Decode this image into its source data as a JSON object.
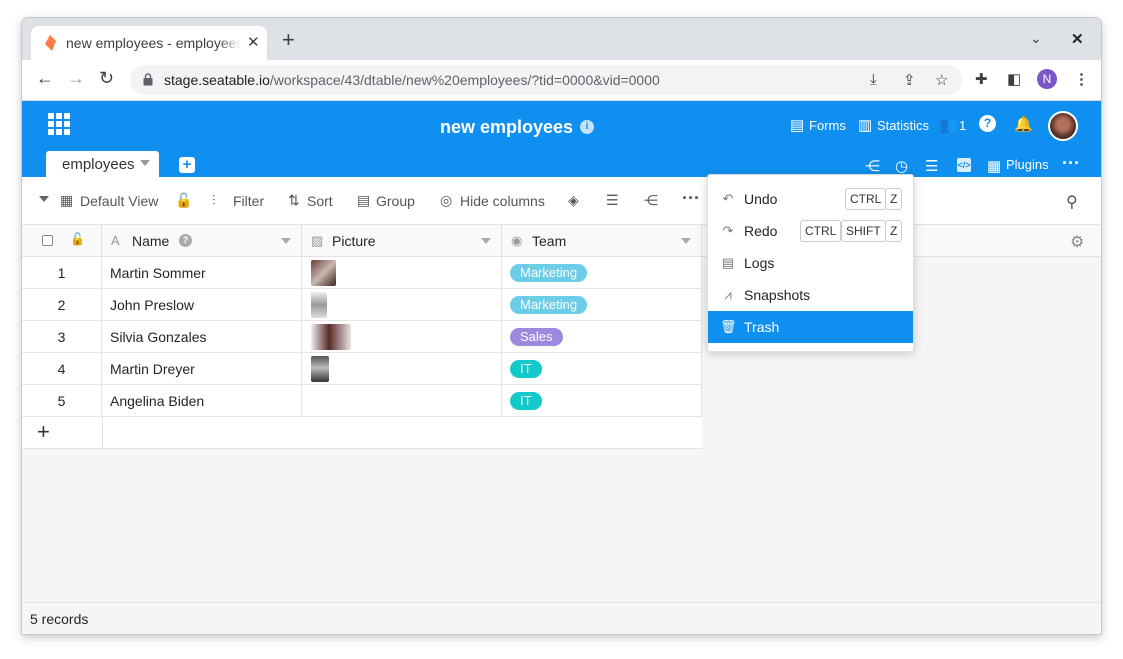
{
  "browser": {
    "tab_title": "new employees - employees",
    "url_host": "stage.seatable.io",
    "url_path": "/workspace/43/dtable/new%20employees/?tid=0000&vid=0000",
    "profile_initial": "N"
  },
  "app": {
    "base_title": "new employees",
    "header_links": {
      "forms": "Forms",
      "statistics": "Statistics",
      "collaborators_count": "1"
    },
    "table_tab": "employees",
    "plugins": "Plugins"
  },
  "viewbar": {
    "view_name": "Default View",
    "filter": "Filter",
    "sort": "Sort",
    "group": "Group",
    "hide_columns": "Hide columns"
  },
  "columns": {
    "name": "Name",
    "picture": "Picture",
    "team": "Team"
  },
  "rows": [
    {
      "num": "1",
      "name": "Martin Sommer",
      "team": "Marketing",
      "team_color": "#6dcce6",
      "has_picture": true
    },
    {
      "num": "2",
      "name": "John Preslow",
      "team": "Marketing",
      "team_color": "#6dcce6",
      "has_picture": true
    },
    {
      "num": "3",
      "name": "Silvia Gonzales",
      "team": "Sales",
      "team_color": "#9c8ae0",
      "has_picture": true
    },
    {
      "num": "4",
      "name": "Martin Dreyer",
      "team": "IT",
      "team_color": "#14c9c9",
      "has_picture": true
    },
    {
      "num": "5",
      "name": "Angelina Biden",
      "team": "IT",
      "team_color": "#14c9c9",
      "has_picture": false
    }
  ],
  "footer": {
    "records": "5 records"
  },
  "menu": {
    "undo": "Undo",
    "redo": "Redo",
    "logs": "Logs",
    "snapshots": "Snapshots",
    "trash": "Trash",
    "key_ctrl": "CTRL",
    "key_shift": "SHIFT",
    "key_z": "Z"
  },
  "colors": {
    "accent": "#0f90f0"
  }
}
